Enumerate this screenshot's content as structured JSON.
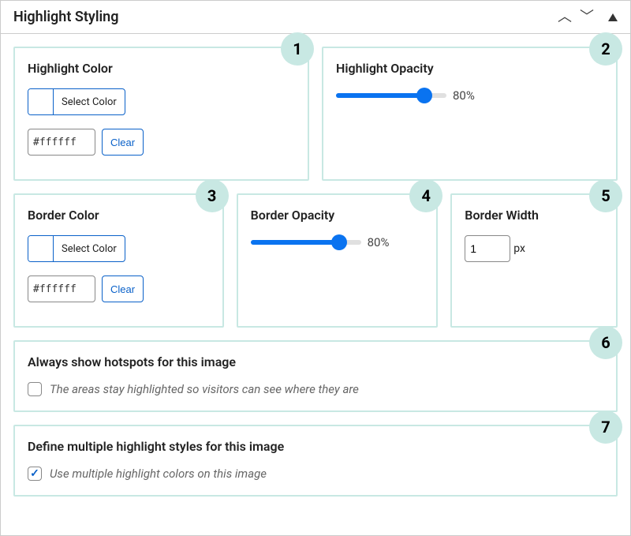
{
  "header": {
    "title": "Highlight Styling"
  },
  "cards": {
    "highlight_color": {
      "title": "Highlight Color",
      "select_label": "Select Color",
      "hex_value": "#ffffff",
      "clear_label": "Clear",
      "badge": "1"
    },
    "highlight_opacity": {
      "title": "Highlight Opacity",
      "value_label": "80%",
      "percent": 80,
      "badge": "2"
    },
    "border_color": {
      "title": "Border Color",
      "select_label": "Select Color",
      "hex_value": "#ffffff",
      "clear_label": "Clear",
      "badge": "3"
    },
    "border_opacity": {
      "title": "Border Opacity",
      "value_label": "80%",
      "percent": 80,
      "badge": "4"
    },
    "border_width": {
      "title": "Border Width",
      "value": "1",
      "unit": "px",
      "badge": "5"
    },
    "always_show": {
      "title": "Always show hotspots for this image",
      "hint": "The areas stay highlighted so visitors can see where they are",
      "checked": false,
      "badge": "6"
    },
    "multiple_styles": {
      "title": "Define multiple highlight styles for this image",
      "hint": "Use multiple highlight colors on this image",
      "checked": true,
      "badge": "7"
    }
  }
}
